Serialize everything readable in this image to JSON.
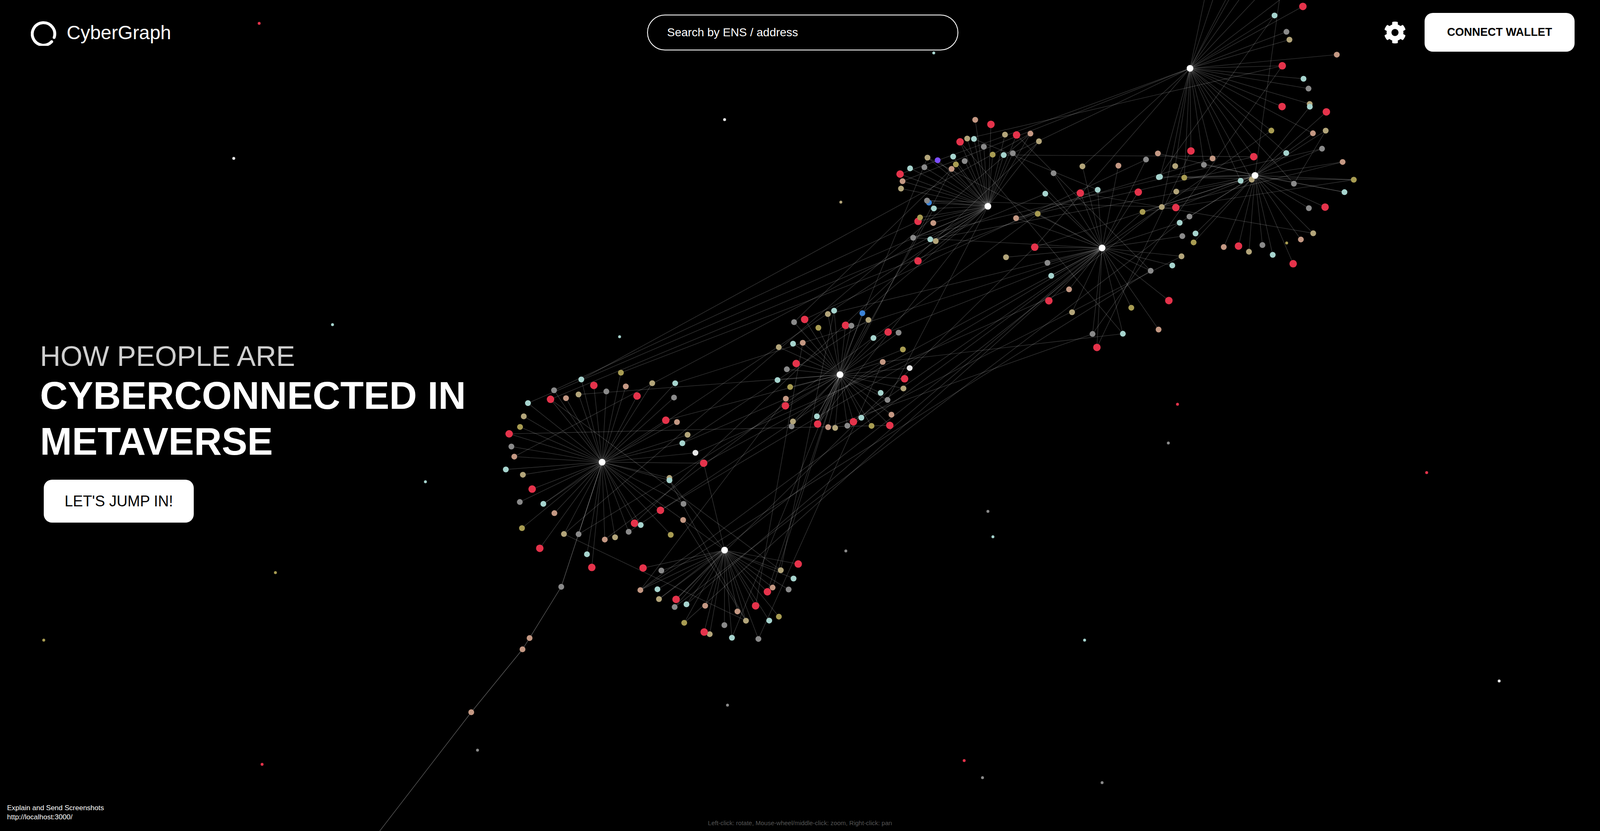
{
  "header": {
    "logo": "CyberGraph",
    "search": {
      "placeholder": "Search by ENS / address"
    },
    "connect_button": "CONNECT WALLET"
  },
  "hero": {
    "kicker": "HOW PEOPLE ARE",
    "title_lines": [
      "CYBERCONNECTED IN",
      "METAVERSE"
    ],
    "cta": "LET'S JUMP IN!"
  },
  "graph": {
    "clusters": [
      {
        "colors": [
          "#e5334b",
          "#b3a57a",
          "#a6d4ce",
          "#8a8a8a",
          "#c49883",
          "#e5334b",
          "#a89c52",
          "#a6d4ce",
          "#e5334b",
          "#8a8a8a",
          "#b3a57a",
          "#c49883",
          "#e5334b",
          "#a6d4ce",
          "#8a8a8a",
          "#b3a57a",
          "#e5334b",
          "#c49883",
          "#a89c52",
          "#a6d4ce",
          "#8a8a8a",
          "#e5334b",
          "#b3a57a",
          "#a6d4ce",
          "#c49883",
          "#8a8a8a",
          "#e5334b",
          "#a89c52",
          "#b3a57a",
          "#a6d4ce",
          "#e5334b",
          "#8a8a8a",
          "#c49883",
          "#b3a57a",
          "#a6d4ce",
          "#e5334b",
          "#8a8a8a",
          "#a89c52",
          "#c49883",
          "#e5334b",
          "#b3a57a",
          "#a6d4ce",
          "#8a8a8a",
          "#e5334b",
          "#c49883",
          "#b3a57a",
          "#a6d4ce",
          "#e8e8e8"
        ]
      },
      {
        "colors": [
          "#e5334b",
          "#b3a57a",
          "#a6d4ce",
          "#8a8a8a",
          "#c49883",
          "#e5334b",
          "#a89c52",
          "#a6d4ce",
          "#e5334b",
          "#8a8a8a",
          "#b3a57a",
          "#c49883",
          "#a6d4ce",
          "#8a8a8a",
          "#b3a57a",
          "#e5334b",
          "#c49883",
          "#a89c52",
          "#a6d4ce",
          "#8a8a8a",
          "#e5334b",
          "#b3a57a",
          "#a6d4ce",
          "#c49883",
          "#8a8a8a",
          "#e5334b"
        ]
      },
      {
        "colors": [
          "#e5334b",
          "#b3a57a",
          "#a6d4ce",
          "#8a8a8a",
          "#c49883",
          "#e5334b",
          "#a89c52",
          "#a6d4ce",
          "#e5334b",
          "#8a8a8a",
          "#b3a57a",
          "#c49883",
          "#e5334b",
          "#a6d4ce",
          "#8a8a8a",
          "#b3a57a",
          "#e5334b",
          "#c49883",
          "#a89c52",
          "#a6d4ce",
          "#8a8a8a",
          "#e5334b",
          "#b3a57a",
          "#a6d4ce",
          "#c49883",
          "#8a8a8a",
          "#e5334b",
          "#a89c52",
          "#b3a57a",
          "#a6d4ce",
          "#e5334b",
          "#8a8a8a",
          "#3b82d6",
          "#b3a57a",
          "#a6d4ce",
          "#e5334b",
          "#8a8a8a",
          "#a89c52",
          "#c49883",
          "#e8e8e8"
        ]
      },
      {
        "colors": [
          "#e5334b",
          "#b3a57a",
          "#a6d4ce",
          "#8a8a8a",
          "#c49883",
          "#e5334b",
          "#a89c52",
          "#a6d4ce",
          "#3b82d6",
          "#8a8a8a",
          "#b3a57a",
          "#c49883",
          "#e5334b",
          "#a6d4ce",
          "#8a8a8a",
          "#b3a57a",
          "#7c4dff",
          "#c49883",
          "#a89c52",
          "#a6d4ce",
          "#8a8a8a",
          "#e5334b",
          "#b3a57a",
          "#a6d4ce",
          "#c49883",
          "#8a8a8a",
          "#e5334b",
          "#a89c52",
          "#b3a57a",
          "#a6d4ce",
          "#e5334b",
          "#8a8a8a",
          "#c49883",
          "#b3a57a"
        ]
      },
      {
        "colors": [
          "#b3a57a",
          "#a6d4ce",
          "#8a8a8a",
          "#e5334b",
          "#c49883",
          "#a89c52",
          "#a6d4ce",
          "#e5334b",
          "#8a8a8a",
          "#b3a57a",
          "#c49883",
          "#e5334b",
          "#a6d4ce",
          "#8a8a8a",
          "#b3a57a",
          "#e5334b",
          "#c49883",
          "#a89c52",
          "#a6d4ce",
          "#8a8a8a",
          "#e5334b",
          "#b3a57a",
          "#a6d4ce",
          "#c49883",
          "#8a8a8a",
          "#e5334b",
          "#a89c52",
          "#b3a57a",
          "#a6d4ce",
          "#8a8a8a"
        ]
      },
      {
        "colors": [
          "#e5334b",
          "#b3a57a",
          "#a6d4ce",
          "#8a8a8a",
          "#c49883",
          "#e5334b",
          "#a89c52",
          "#a6d4ce",
          "#e5334b",
          "#8a8a8a",
          "#b3a57a",
          "#c49883",
          "#e5334b",
          "#a6d4ce",
          "#8a8a8a",
          "#b3a57a",
          "#e5334b",
          "#c49883",
          "#a89c52",
          "#a6d4ce",
          "#8a8a8a",
          "#e5334b",
          "#b3a57a",
          "#a6d4ce",
          "#c49883",
          "#8a8a8a",
          "#e5334b",
          "#a89c52",
          "#b3a57a",
          "#a6d4ce"
        ]
      },
      {
        "colors": [
          "#a6d4ce",
          "#e5334b",
          "#b3a57a",
          "#8a8a8a",
          "#c49883",
          "#a89c52",
          "#a6d4ce",
          "#e5334b",
          "#8a8a8a",
          "#b3a57a",
          "#c49883",
          "#e5334b",
          "#a6d4ce",
          "#8a8a8a",
          "#b3a57a",
          "#e5334b",
          "#c49883",
          "#a89c52",
          "#a6d4ce",
          "#8a8a8a",
          "#e5334b",
          "#b3a57a",
          "#a6d4ce",
          "#c49883"
        ]
      }
    ],
    "links": [
      [
        0,
        1
      ],
      [
        0,
        2
      ],
      [
        0,
        3
      ],
      [
        1,
        2
      ],
      [
        2,
        3
      ],
      [
        2,
        4
      ],
      [
        3,
        4
      ],
      [
        4,
        5
      ],
      [
        4,
        6
      ],
      [
        5,
        6
      ],
      [
        0,
        4
      ],
      [
        1,
        4
      ],
      [
        3,
        5
      ]
    ],
    "tail": [
      "#8a8a8a",
      "#c49883",
      "#c49883",
      "#c49883"
    ],
    "stars": [
      "#e5334b",
      "#e8e8e8",
      "#e8e8e8",
      "#a6d4ce",
      "#b3a57a",
      "#a6d4ce",
      "#a6d4ce",
      "#e5334b",
      "#8a8a8a",
      "#e5334b",
      "#a6d4ce",
      "#8a8a8a",
      "#a6d4ce",
      "#8a8a8a",
      "#a89c52",
      "#a89c52",
      "#a6d4ce",
      "#e8e8e8",
      "#8a8a8a",
      "#8a8a8a",
      "#e5334b",
      "#e5334b",
      "#8a8a8a",
      "#8a8a8a",
      "#a89c52"
    ]
  },
  "controls_hint": "Left-click: rotate, Mouse-wheel/middle-click: zoom, Right-click: pan",
  "debug": {
    "label": "Explain and Send Screenshots",
    "url": "http://localhost:3000/"
  }
}
